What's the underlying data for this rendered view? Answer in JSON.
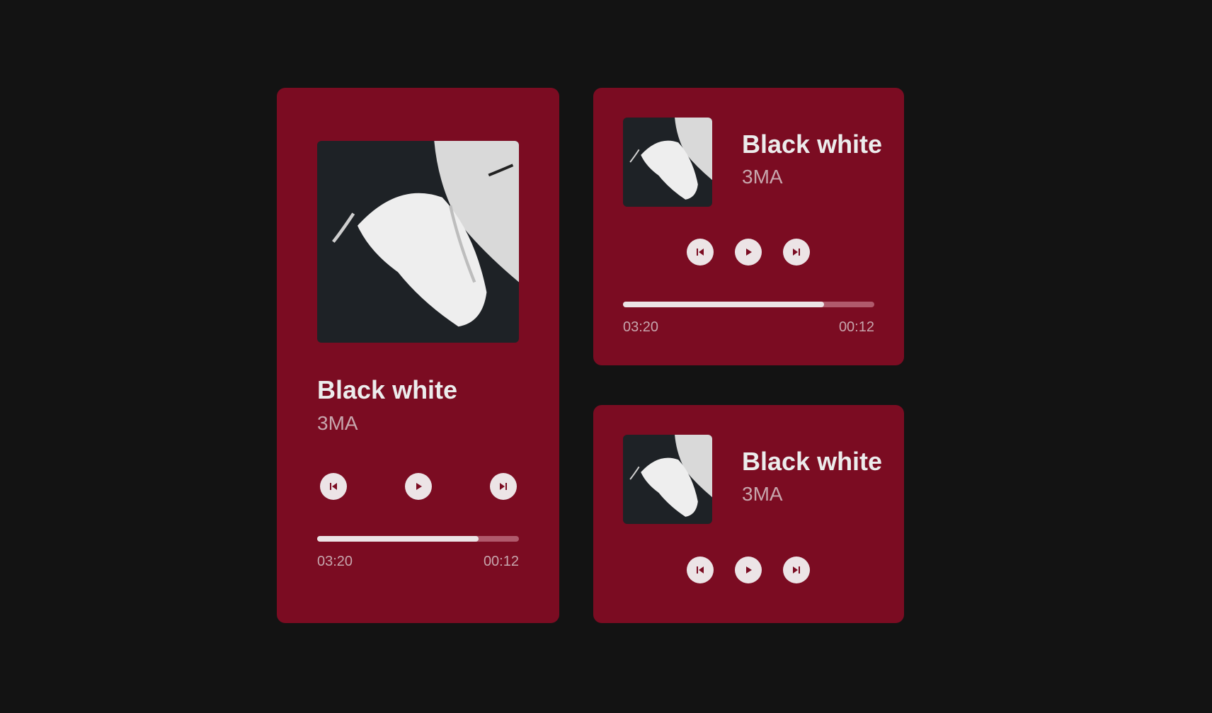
{
  "colors": {
    "background": "#131313",
    "card": "#7b0c22",
    "button": "#ece4e6",
    "icon": "#7b0c22",
    "progress_track": "#b05a6c",
    "progress_fill": "#ece4e6",
    "title_text": "#ececec",
    "secondary_text": "#c7a6ad"
  },
  "players": [
    {
      "variant": "large",
      "title": "Black white",
      "artist": "3MA",
      "progress": 0.8,
      "time_elapsed": "03:20",
      "time_remaining": "00:12",
      "controls": [
        "previous-icon",
        "play-icon",
        "next-icon"
      ]
    },
    {
      "variant": "medium",
      "title": "Black white",
      "artist": "3MA",
      "progress": 0.8,
      "time_elapsed": "03:20",
      "time_remaining": "00:12",
      "controls": [
        "previous-icon",
        "play-icon",
        "next-icon"
      ]
    },
    {
      "variant": "small",
      "title": "Black white",
      "artist": "3MA",
      "controls": [
        "previous-icon",
        "play-icon",
        "next-icon"
      ]
    }
  ]
}
